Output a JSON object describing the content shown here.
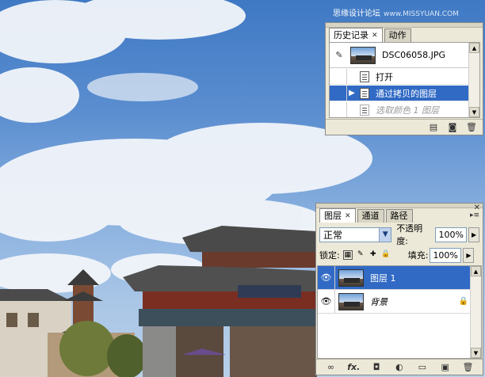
{
  "watermark": {
    "text": "思缘设计论坛",
    "site": "www.MISSYUAN.COM"
  },
  "history_panel": {
    "tabs": [
      {
        "label": "历史记录",
        "active": true
      },
      {
        "label": "动作",
        "active": false
      }
    ],
    "snapshot_name": "DSC06058.JPG",
    "steps": [
      {
        "label": "打开",
        "state": "normal"
      },
      {
        "label": "通过拷贝的图层",
        "state": "selected"
      },
      {
        "label": "选取颜色 1 图层",
        "state": "faded"
      }
    ],
    "footer_icons": [
      "new-document-from-state-icon",
      "new-snapshot-icon",
      "delete-state-icon"
    ]
  },
  "layers_panel": {
    "tabs": [
      {
        "label": "图层",
        "active": true
      },
      {
        "label": "通道",
        "active": false
      },
      {
        "label": "路径",
        "active": false
      }
    ],
    "blend_mode": "正常",
    "opacity_label": "不透明度:",
    "opacity_value": "100%",
    "lock_label": "锁定:",
    "fill_label": "填充:",
    "fill_value": "100%",
    "layers": [
      {
        "name": "图层 1",
        "selected": true,
        "locked": false
      },
      {
        "name": "背景",
        "selected": false,
        "locked": true
      }
    ],
    "footer_icons": [
      "link-layers-icon",
      "layer-style-icon",
      "layer-mask-icon",
      "adjustment-layer-icon",
      "new-group-icon",
      "new-layer-icon",
      "delete-layer-icon"
    ],
    "fx_label": "fx."
  },
  "colors": {
    "selection": "#316ac5",
    "panel_bg": "#ece9d8"
  }
}
